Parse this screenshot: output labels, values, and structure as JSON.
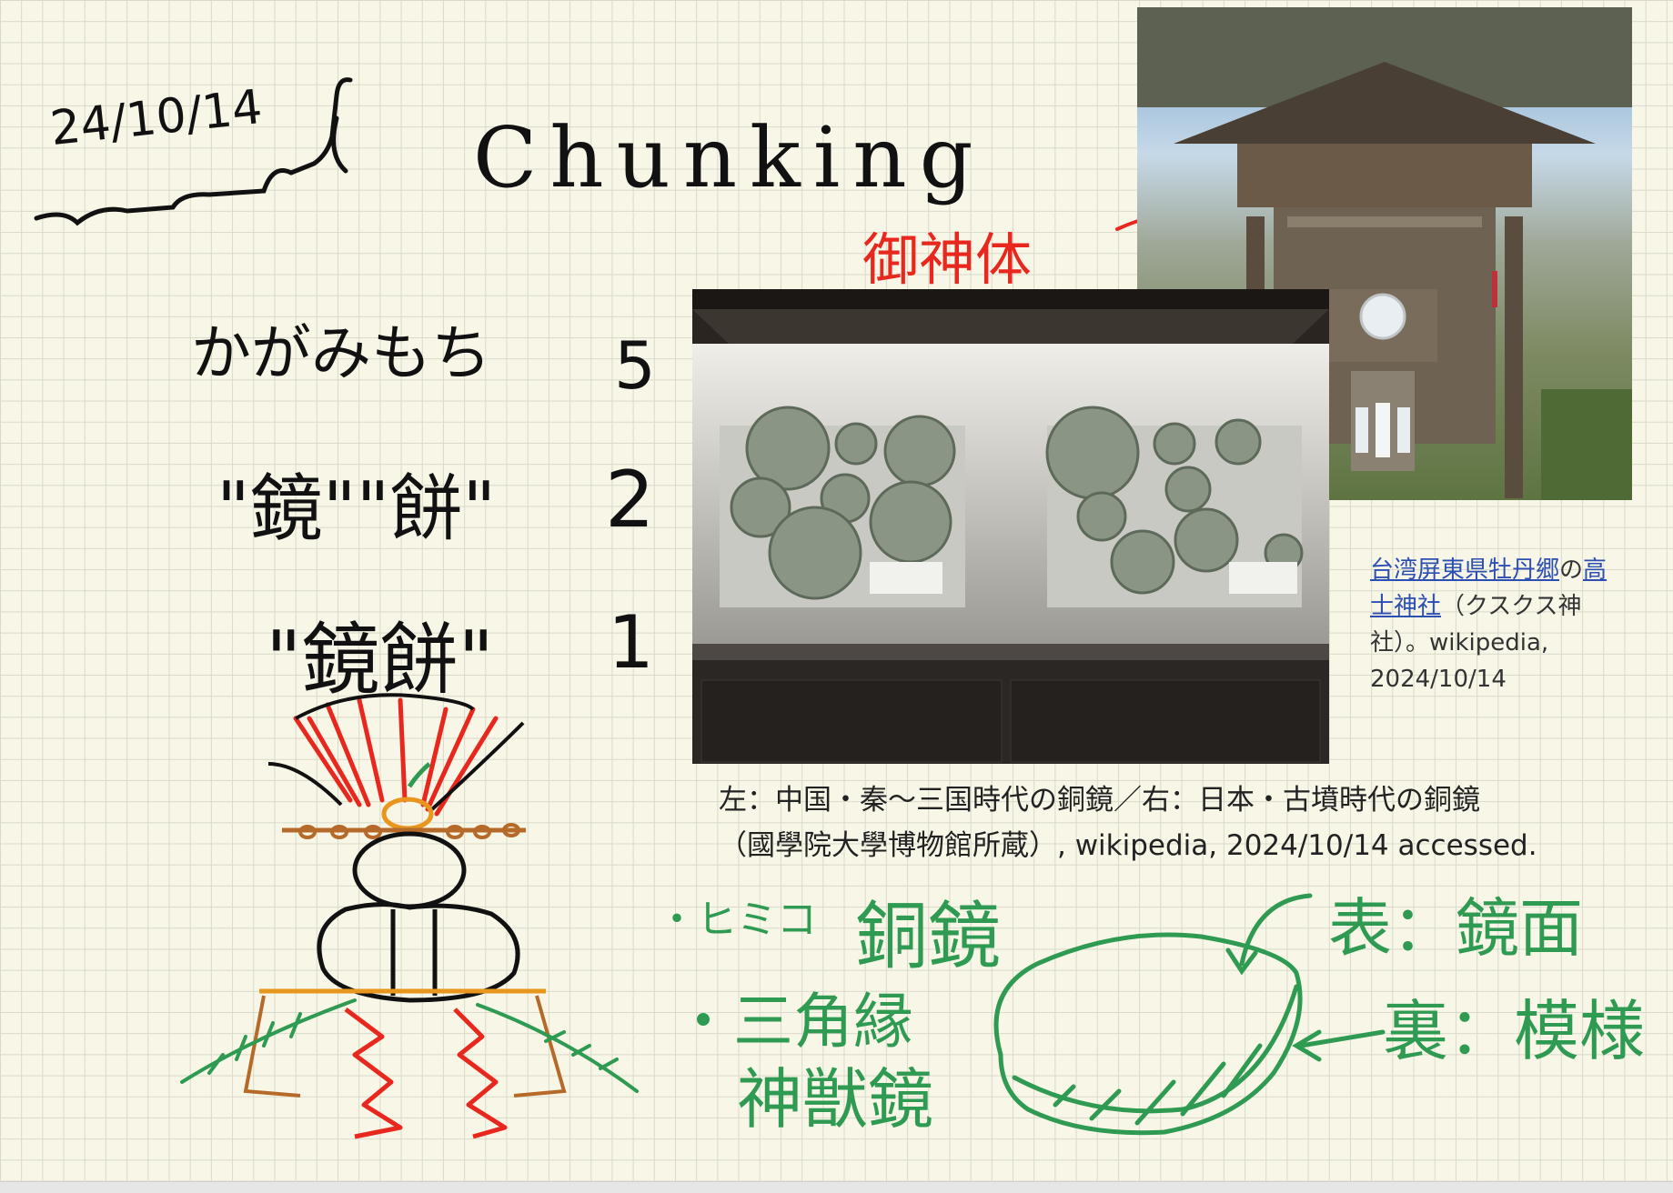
{
  "notes": {
    "date": "24/10/14",
    "title": "Chunking",
    "goshintai_label": "御神体",
    "rows": [
      {
        "text": "かがみもち",
        "count": "5"
      },
      {
        "text": "\"鏡\"\"餅\"",
        "count": "2"
      },
      {
        "text": "\"鏡餅\"",
        "count": "1"
      }
    ],
    "himiko": "・ヒミコ",
    "dokyo": "銅鏡",
    "sankaku_1": "・三角縁",
    "sankaku_2": "神獣鏡",
    "omote": "表：鏡面",
    "ura": "裏：模様"
  },
  "shrine_caption": {
    "link1": "台湾屏東県牡丹郷",
    "no": "の",
    "link2a": "高",
    "link2b": "士神社",
    "rest_line2": "（クスクス神",
    "line3": "社）。wikipedia,",
    "line4": "2024/10/14"
  },
  "mirror_caption": {
    "line1": "左：中国・秦〜三国時代の銅鏡／右：日本・古墳時代の銅鏡",
    "line2": "（國學院大學博物館所蔵）, wikipedia, 2024/10/14 accessed."
  },
  "colors": {
    "ink_black": "#111111",
    "ink_red": "#e8281e",
    "ink_green": "#2f9a52",
    "ink_orange": "#e8961e",
    "ink_brown": "#b56a2a",
    "link_blue": "#2b4fb3"
  }
}
